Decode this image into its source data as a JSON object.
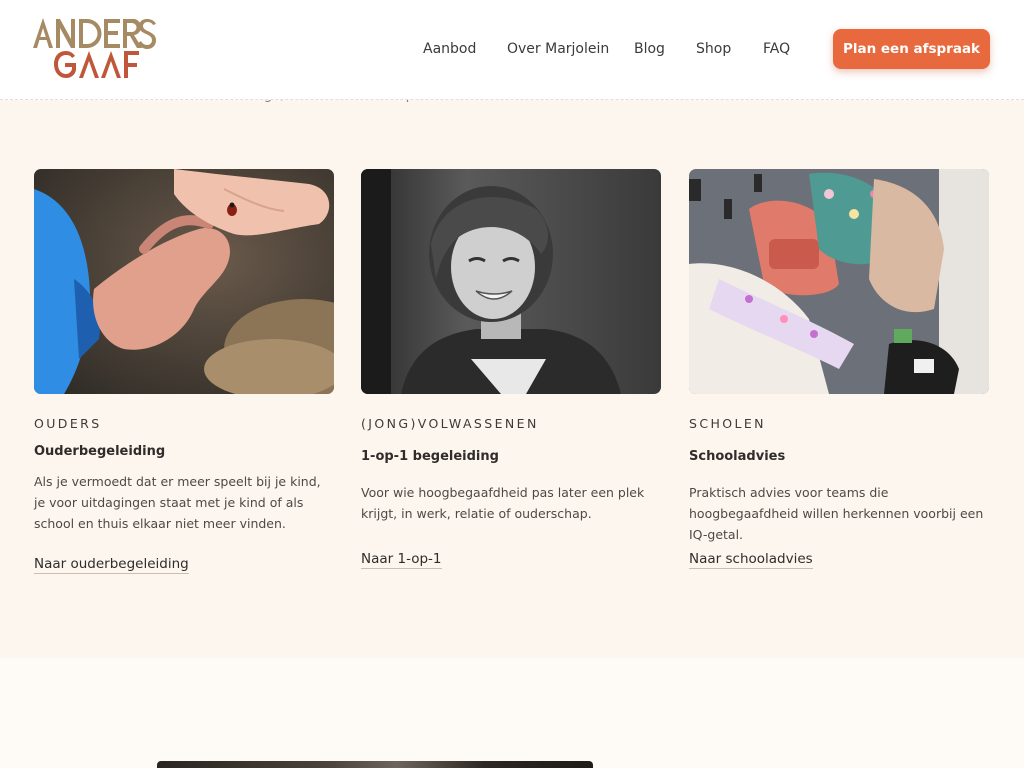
{
  "brand": {
    "logo_line1": "ANDERS",
    "logo_line2": "GAAF"
  },
  "nav": {
    "items": [
      "Aanbod",
      "Over Marjolein",
      "Blog",
      "Shop",
      "FAQ"
    ],
    "cta": "Plan een afspraak"
  },
  "intro_fragment": "verschillende routes. Besloten rustige, onderbouwde aanpak.",
  "cards": [
    {
      "eyebrow": "OUDERS",
      "title": "Ouderbegeleiding",
      "description": "Als je vermoedt dat er meer speelt bij je kind, je voor uitdagingen staat met je kind of als school en thuis elkaar niet meer vinden.",
      "link": "Naar ouderbegeleiding"
    },
    {
      "eyebrow": "(JONG)VOLWASSENEN",
      "title": "1-op-1 begeleiding",
      "description": "Voor wie hoogbegaafdheid pas later een plek krijgt, in werk, relatie of ouderschap.",
      "link": "Naar 1-op-1"
    },
    {
      "eyebrow": "SCHOLEN",
      "title": "Schooladvies",
      "description": "Praktisch advies voor teams die hoogbegaafdheid willen herkennen voorbij een IQ-getal.",
      "link": "Naar schooladvies"
    }
  ],
  "colors": {
    "accent": "#e7693d",
    "background": "#fdf6ee",
    "logo_gold": "#a58a63",
    "logo_rust": "#c0563a"
  }
}
